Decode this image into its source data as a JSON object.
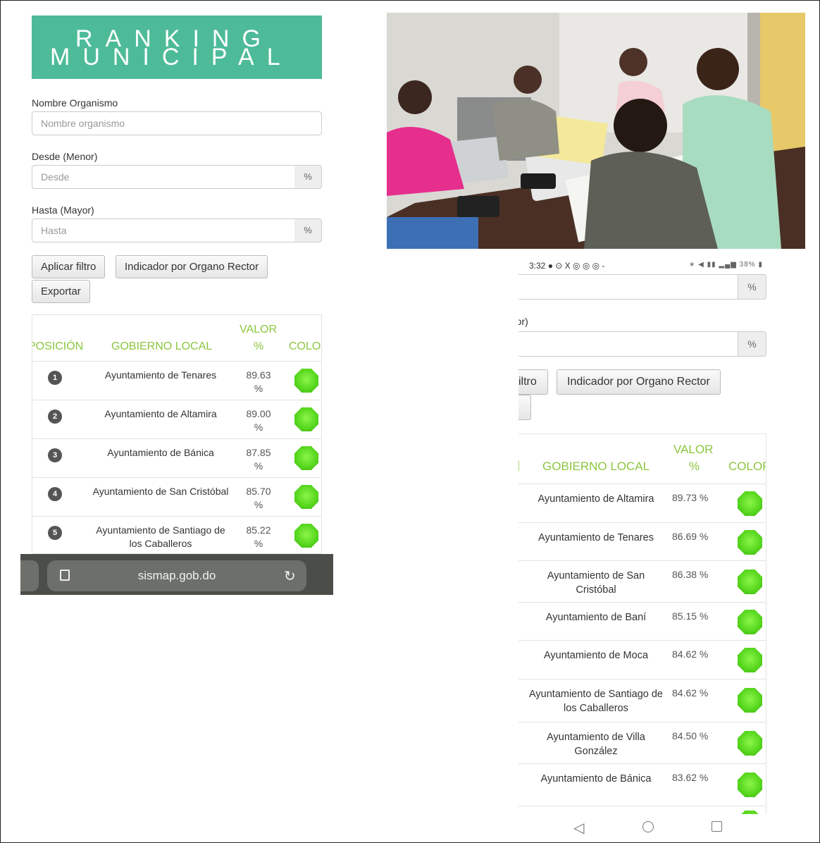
{
  "left": {
    "logo": {
      "line1": "RANKING",
      "line2": "MUNICIPAL"
    },
    "form": {
      "nombre_label": "Nombre Organismo",
      "nombre_placeholder": "Nombre organismo",
      "desde_label": "Desde (Menor)",
      "desde_placeholder": "Desde",
      "hasta_label": "Hasta (Mayor)",
      "hasta_placeholder": "Hasta",
      "percent": "%"
    },
    "buttons": {
      "apply": "Aplicar filtro",
      "indicator": "Indicador por Organo Rector",
      "export": "Exportar"
    },
    "table": {
      "headers": {
        "position": "POSICIÓN",
        "gov": "GOBIERNO LOCAL",
        "value_line1": "VALOR",
        "value_line2": "%",
        "color": "COLOR"
      },
      "rows": [
        {
          "pos": "1",
          "name": "Ayuntamiento de Tenares",
          "value": "89.63",
          "unit": "%"
        },
        {
          "pos": "2",
          "name": "Ayuntamiento de Altamira",
          "value": "89.00",
          "unit": "%"
        },
        {
          "pos": "3",
          "name": "Ayuntamiento de Bánica",
          "value": "87.85",
          "unit": "%"
        },
        {
          "pos": "4",
          "name": "Ayuntamiento de San Cristóbal",
          "value": "85.70",
          "unit": "%"
        },
        {
          "pos": "5",
          "name": "Ayuntamiento de Santiago de los Caballeros",
          "value": "85.22",
          "unit": "%"
        }
      ]
    },
    "urlbar": {
      "url": "sismap.gob.do"
    }
  },
  "right": {
    "status": {
      "time": "3:32",
      "apps": "● ⊙ X ◎ ◎ ◎  -",
      "battery": "38%"
    },
    "form": {
      "percent": "%",
      "label_partial": "'or)"
    },
    "buttons": {
      "apply_partial": "iltro",
      "indicator": "Indicador por Organo Rector"
    },
    "table": {
      "headers": {
        "gov": "GOBIERNO LOCAL",
        "value_line1": "VALOR",
        "value_line2": "%",
        "color": "COLOR"
      },
      "rows": [
        {
          "name": "Ayuntamiento de Altamira",
          "value": "89.73 %"
        },
        {
          "name": "Ayuntamiento de Tenares",
          "value": "86.69 %"
        },
        {
          "name": "Ayuntamiento de San Cristóbal",
          "value": "86.38 %"
        },
        {
          "name": "Ayuntamiento de Baní",
          "value": "85.15 %"
        },
        {
          "name": "Ayuntamiento de Moca",
          "value": "84.62 %"
        },
        {
          "name": "Ayuntamiento de Santiago de los Caballeros",
          "value": "84.62 %"
        },
        {
          "name": "Ayuntamiento de Villa González",
          "value": "84.50 %"
        },
        {
          "name": "Ayuntamiento de Bánica",
          "value": "83.62 %"
        }
      ]
    }
  },
  "colors": {
    "accent_green": "#8cc63f",
    "logo_teal": "#4ebb98",
    "indicator_green": "#55d61c"
  }
}
